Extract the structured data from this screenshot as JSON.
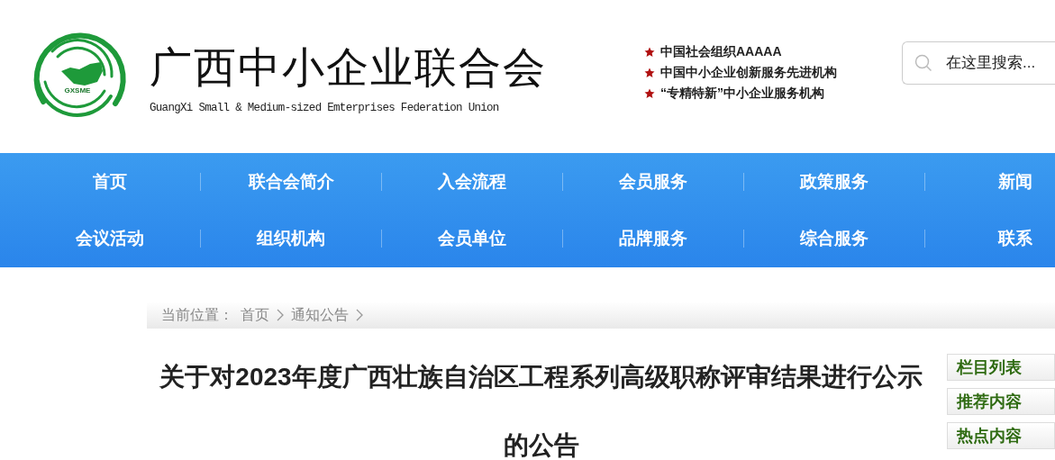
{
  "header": {
    "logo_mark": "GXSME",
    "title": "广西中小企业联合会",
    "subtitle": "GuangXi Small & Medium-sized Emterprises Federation Union",
    "honors": [
      "中国社会组织AAAAA",
      "中国中小企业创新服务先进机构",
      "“专精特新”中小企业服务机构"
    ],
    "search": {
      "placeholder": "在这里搜索..."
    }
  },
  "nav": [
    [
      "首页",
      "联合会简介",
      "入会流程",
      "会员服务",
      "政策服务",
      "新闻"
    ],
    [
      "会议活动",
      "组织机构",
      "会员单位",
      "品牌服务",
      "综合服务",
      "联系"
    ]
  ],
  "breadcrumb": {
    "label": "当前位置：",
    "items": [
      "首页",
      "通知公告"
    ]
  },
  "article": {
    "title": "关于对2023年度广西壮族自治区工程系列高级职称评审结果进行公示的公告"
  },
  "sidebar": [
    "栏目列表",
    "推荐内容",
    "热点内容"
  ]
}
